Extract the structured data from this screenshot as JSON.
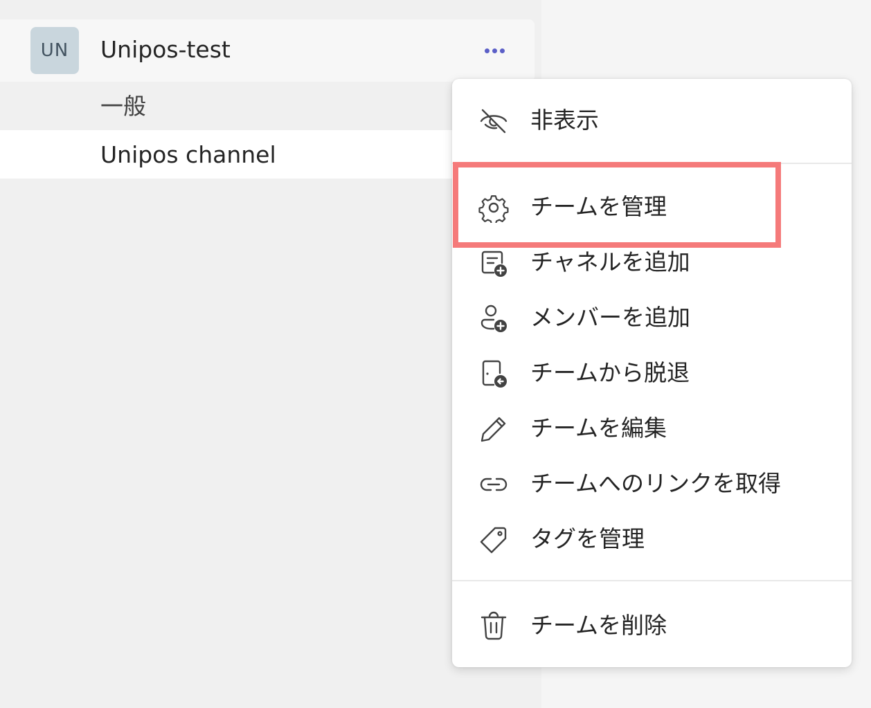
{
  "team": {
    "avatar_initials": "UN",
    "name": "Unipos-test",
    "more_icon": "more-horizontal-icon"
  },
  "channels": [
    {
      "label": "一般",
      "selected": false
    },
    {
      "label": "Unipos channel",
      "selected": true
    }
  ],
  "context_menu": {
    "items": [
      {
        "label": "非表示",
        "icon": "eye-off-icon"
      },
      {
        "label": "チームを管理",
        "icon": "gear-icon",
        "highlighted": true
      },
      {
        "label": "チャネルを追加",
        "icon": "add-channel-icon"
      },
      {
        "label": "メンバーを追加",
        "icon": "add-person-icon"
      },
      {
        "label": "チームから脱退",
        "icon": "leave-icon"
      },
      {
        "label": "チームを編集",
        "icon": "pencil-icon"
      },
      {
        "label": "チームへのリンクを取得",
        "icon": "link-icon"
      },
      {
        "label": "タグを管理",
        "icon": "tag-icon"
      },
      {
        "label": "チームを削除",
        "icon": "trash-icon"
      }
    ]
  },
  "colors": {
    "accent": "#5b5fc7",
    "highlight_border": "#f57a7a",
    "avatar_bg": "#c9d6dd"
  }
}
